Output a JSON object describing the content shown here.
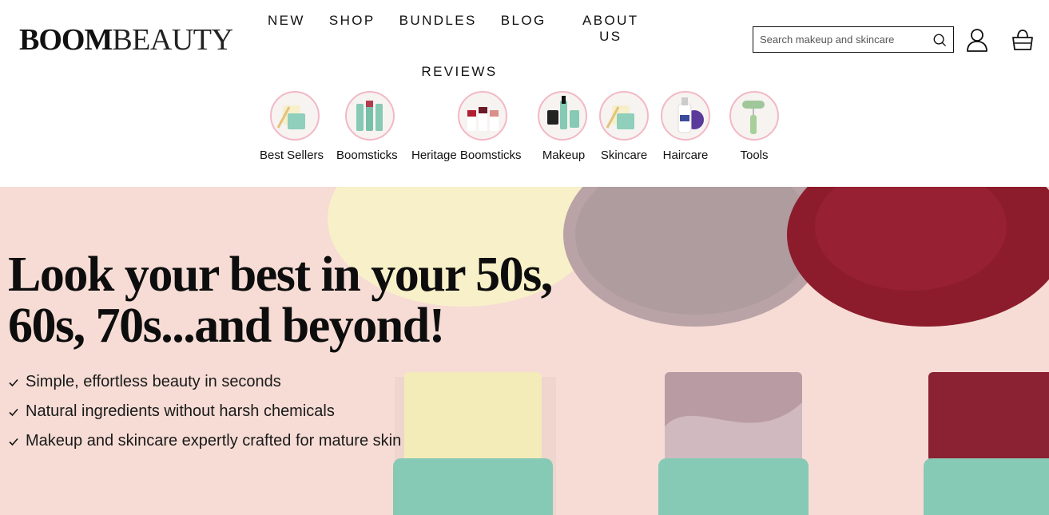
{
  "brand": {
    "part1": "BOOM",
    "part2": "BEAUTY"
  },
  "nav": {
    "row1": [
      "NEW",
      "SHOP",
      "BUNDLES",
      "BLOG",
      "ABOUT US"
    ],
    "row2": [
      "REVIEWS"
    ]
  },
  "search": {
    "placeholder": "Search makeup and skincare"
  },
  "icons": {
    "search": "search-icon",
    "account": "user-icon",
    "cart": "bag-icon"
  },
  "categories": [
    {
      "label": "Best Sellers",
      "icon": "jar-product-thumb"
    },
    {
      "label": "Boomsticks",
      "icon": "sticks-thumb"
    },
    {
      "label": "Heritage Boomsticks",
      "icon": "heritage-sticks-thumb"
    },
    {
      "label": "Makeup",
      "icon": "mascara-thumb"
    },
    {
      "label": "Skincare",
      "icon": "jar-product-thumb"
    },
    {
      "label": "Haircare",
      "icon": "bottle-thumb"
    },
    {
      "label": "Tools",
      "icon": "roller-thumb"
    }
  ],
  "hero": {
    "headline_line1": "Look your best in your 50s,",
    "headline_line2": "60s, 70s...and beyond!",
    "benefits": [
      "Simple, effortless beauty in seconds",
      "Natural ingredients without harsh chemicals",
      "Makeup and skincare expertly crafted for mature skin"
    ]
  },
  "colors": {
    "hero_bg": "#f6dcd5",
    "accent_pink": "#f2b8c6",
    "stick_teal": "#86c9b4",
    "berry": "#8c1c2c"
  }
}
